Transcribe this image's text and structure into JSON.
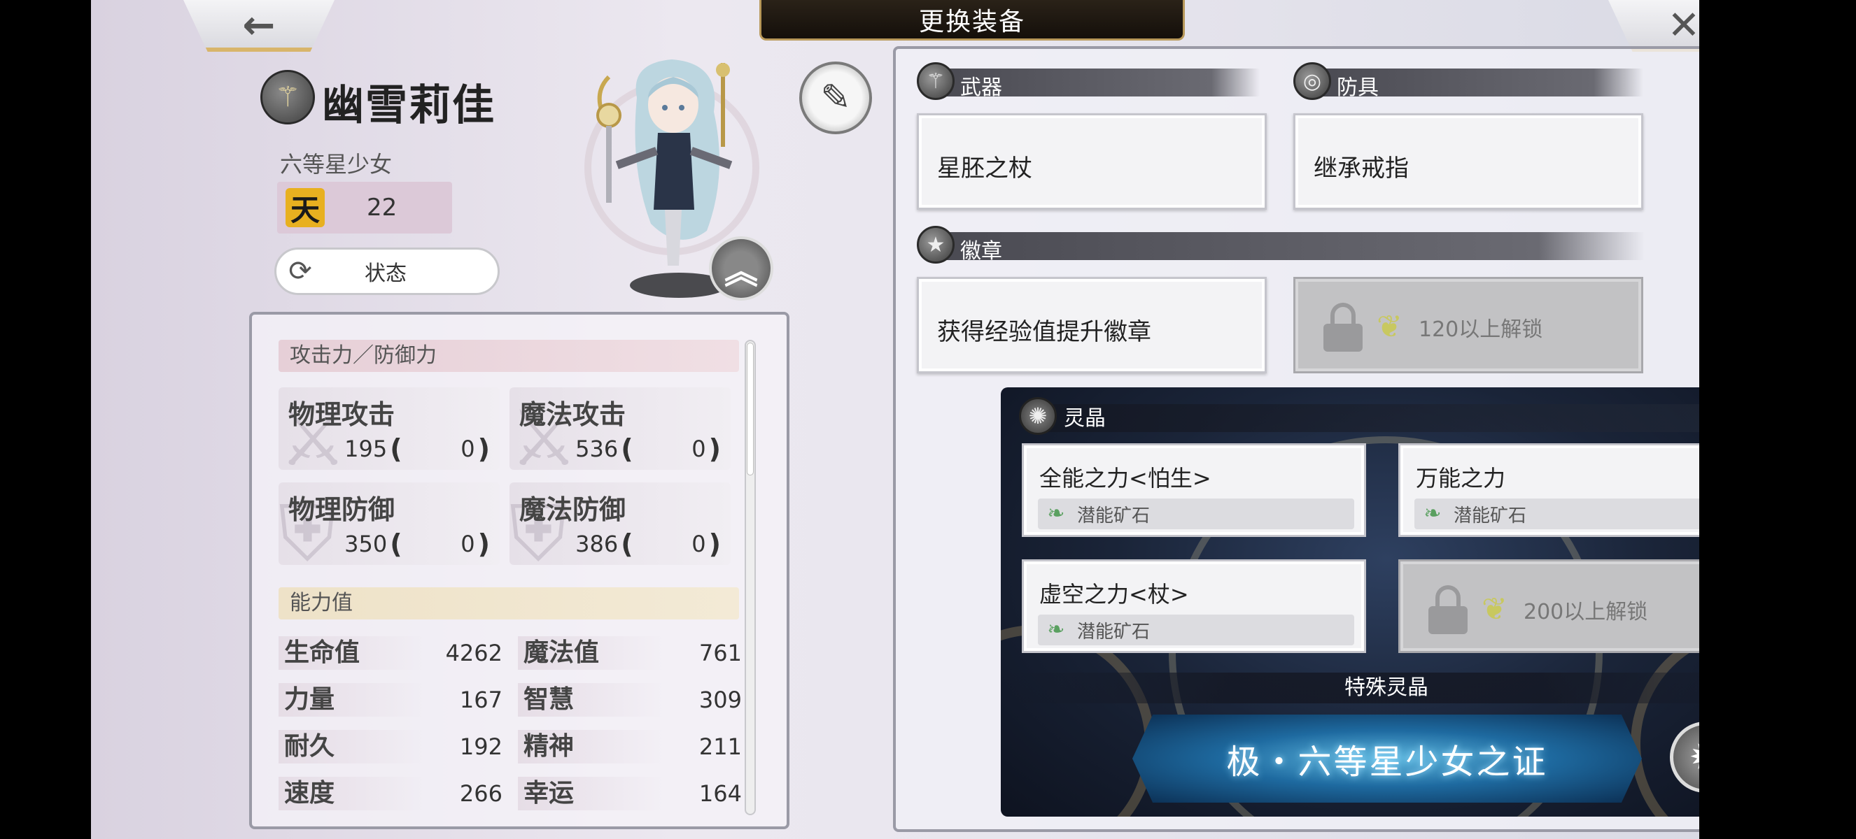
{
  "header": {
    "title": "更换装备",
    "back_icon": "←",
    "close_icon": "✕"
  },
  "character": {
    "name": "幽雪莉佳",
    "title": "六等星少女",
    "rank_badge": "天",
    "rank_value": "22",
    "status_button": "状态",
    "weapon_type_icon": "staff-icon"
  },
  "stats": {
    "attack_section": "攻击力／防御力",
    "attack": [
      {
        "name": "物理攻击",
        "value": "195",
        "bonus": "0"
      },
      {
        "name": "魔法攻击",
        "value": "536",
        "bonus": "0"
      },
      {
        "name": "物理防御",
        "value": "350",
        "bonus": "0"
      },
      {
        "name": "魔法防御",
        "value": "386",
        "bonus": "0"
      }
    ],
    "ability_section": "能力值",
    "abilities": [
      {
        "name": "生命值",
        "value": "4262"
      },
      {
        "name": "魔法值",
        "value": "761"
      },
      {
        "name": "力量",
        "value": "167"
      },
      {
        "name": "智慧",
        "value": "309"
      },
      {
        "name": "耐久",
        "value": "192"
      },
      {
        "name": "精神",
        "value": "211"
      },
      {
        "name": "速度",
        "value": "266"
      },
      {
        "name": "幸运",
        "value": "164"
      }
    ]
  },
  "equipment": {
    "weapon_label": "武器",
    "weapon_item": "星胚之杖",
    "armor_label": "防具",
    "armor_item": "继承戒指",
    "badge_label": "徽章",
    "badge_item": "获得经验值提升徽章",
    "badge_locked_text": "120以上解锁"
  },
  "crystals": {
    "label": "灵晶",
    "items": [
      {
        "name": "全能之力<怕生>",
        "type": "潜能矿石"
      },
      {
        "name": "万能之力",
        "type": "潜能矿石"
      },
      {
        "name": "虚空之力<杖>",
        "type": "潜能矿石"
      }
    ],
    "locked_text": "200以上解锁",
    "special_label": "特殊灵晶",
    "special_item": "极・六等星少女之证"
  }
}
